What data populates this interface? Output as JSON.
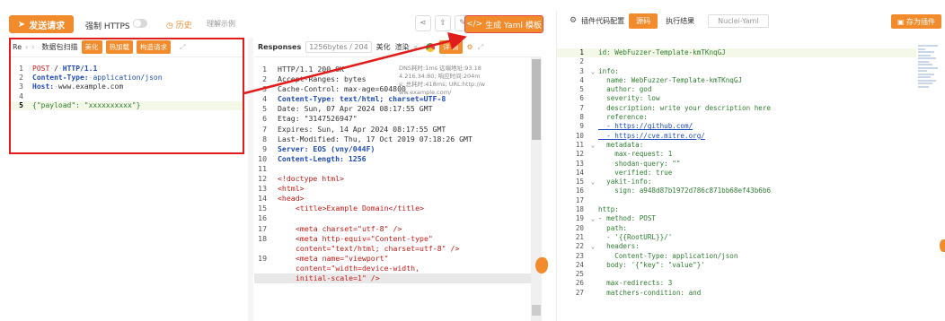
{
  "toolbar": {
    "send_label": "发送请求",
    "force_https_label": "强制 HTTPS",
    "history_label": "历史",
    "understand_label": "理解示例",
    "generate_yaml_label": "生成 Yaml 模板"
  },
  "request": {
    "tab_label": "Re",
    "packet_scan_label": "数据包扫描",
    "beautify_label": "美化",
    "hot_load_label": "热加载",
    "construct_label": "构造请求",
    "lines": [
      {
        "n": "1",
        "text": "POST / HTTP/1.1"
      },
      {
        "n": "2",
        "text": "Content-Type: application/json"
      },
      {
        "n": "3",
        "text": "Host: www.example.com"
      },
      {
        "n": "4",
        "text": ""
      },
      {
        "n": "5",
        "text": "{\"payload\": \"xxxxxxxxxx\"}"
      }
    ]
  },
  "response": {
    "title": "Responses",
    "size_label": "1256bytes / 204",
    "beautify_label": "美化",
    "render_label": "渲染",
    "detail_label": "详 情",
    "overlay_line1": "DNS耗时:1ms  远端地址:93.18",
    "overlay_line2": "4.216.34:80; 响应时间:204m",
    "overlay_line3": "s; 总耗时:418ms; URL:http://w",
    "overlay_line4": "ww.example.com/",
    "lines": [
      {
        "n": "1",
        "text": "HTTP/1.1 200 OK"
      },
      {
        "n": "2",
        "text": "Accept-Ranges: bytes"
      },
      {
        "n": "3",
        "text": "Cache-Control: max-age=604800"
      },
      {
        "n": "4",
        "text": "Content-Type: text/html; charset=UTF-8"
      },
      {
        "n": "5",
        "text": "Date: Sun, 07 Apr 2024 08:17:55 GMT"
      },
      {
        "n": "6",
        "text": "Etag: \"3147526947\""
      },
      {
        "n": "7",
        "text": "Expires: Sun, 14 Apr 2024 08:17:55 GMT"
      },
      {
        "n": "8",
        "text": "Last-Modified: Thu, 17 Oct 2019 07:18:26 GMT"
      },
      {
        "n": "9",
        "text": "Server: EOS (vny/044F)"
      },
      {
        "n": "10",
        "text": "Content-Length: 1256"
      },
      {
        "n": "11",
        "text": ""
      },
      {
        "n": "12",
        "text": "<!doctype html>"
      },
      {
        "n": "13",
        "text": "<html>"
      },
      {
        "n": "14",
        "text": "<head>"
      },
      {
        "n": "15",
        "text": "<title>Example Domain</title>"
      },
      {
        "n": "16",
        "text": ""
      },
      {
        "n": "17",
        "text": "<meta charset=\"utf-8\" />"
      },
      {
        "n": "18",
        "text": "<meta http-equiv=\"Content-type\""
      },
      {
        "n": "",
        "text": "content=\"text/html; charset=utf-8\" />"
      },
      {
        "n": "19",
        "text": "<meta name=\"viewport\""
      },
      {
        "n": "",
        "text": "content=\"width=device-width,"
      },
      {
        "n": "",
        "text": "initial-scale=1\" />"
      }
    ]
  },
  "plugin": {
    "config_label": "插件代码配置",
    "tab_source": "源码",
    "tab_result": "执行结果",
    "tab_nuclei": "Nuclei-Yaml",
    "save_label": "存为插件",
    "lines": [
      {
        "n": "1",
        "text": "id: WebFuzzer-Template-kmTKnqGJ"
      },
      {
        "n": "2",
        "text": ""
      },
      {
        "n": "3",
        "text": "info:"
      },
      {
        "n": "4",
        "text": "  name: WebFuzzer-Template-kmTKnqGJ"
      },
      {
        "n": "5",
        "text": "  author: god"
      },
      {
        "n": "6",
        "text": "  severity: low"
      },
      {
        "n": "7",
        "text": "  description: write your description here"
      },
      {
        "n": "8",
        "text": "  reference:"
      },
      {
        "n": "9",
        "text": "  - https://github.com/"
      },
      {
        "n": "10",
        "text": "  - https://cve.mitre.org/"
      },
      {
        "n": "11",
        "text": "  metadata:"
      },
      {
        "n": "12",
        "text": "    max-request: 1"
      },
      {
        "n": "13",
        "text": "    shodan-query: \"\""
      },
      {
        "n": "14",
        "text": "    verified: true"
      },
      {
        "n": "15",
        "text": "  yakit-info:"
      },
      {
        "n": "16",
        "text": "    sign: a948d87b1972d786c871bb68ef43b6b6"
      },
      {
        "n": "17",
        "text": ""
      },
      {
        "n": "18",
        "text": "http:"
      },
      {
        "n": "19",
        "text": "- method: POST"
      },
      {
        "n": "20",
        "text": "  path:"
      },
      {
        "n": "21",
        "text": "  - '{{RootURL}}/'"
      },
      {
        "n": "22",
        "text": "  headers:"
      },
      {
        "n": "23",
        "text": "    Content-Type: application/json"
      },
      {
        "n": "24",
        "text": "  body: '{\"key\": \"value\"}'"
      },
      {
        "n": "25",
        "text": ""
      },
      {
        "n": "26",
        "text": "  max-redirects: 3"
      },
      {
        "n": "27",
        "text": "  matchers-condition: and"
      }
    ]
  },
  "colors": {
    "accent": "#f28b2c",
    "highlight_border": "#e21b1b"
  }
}
